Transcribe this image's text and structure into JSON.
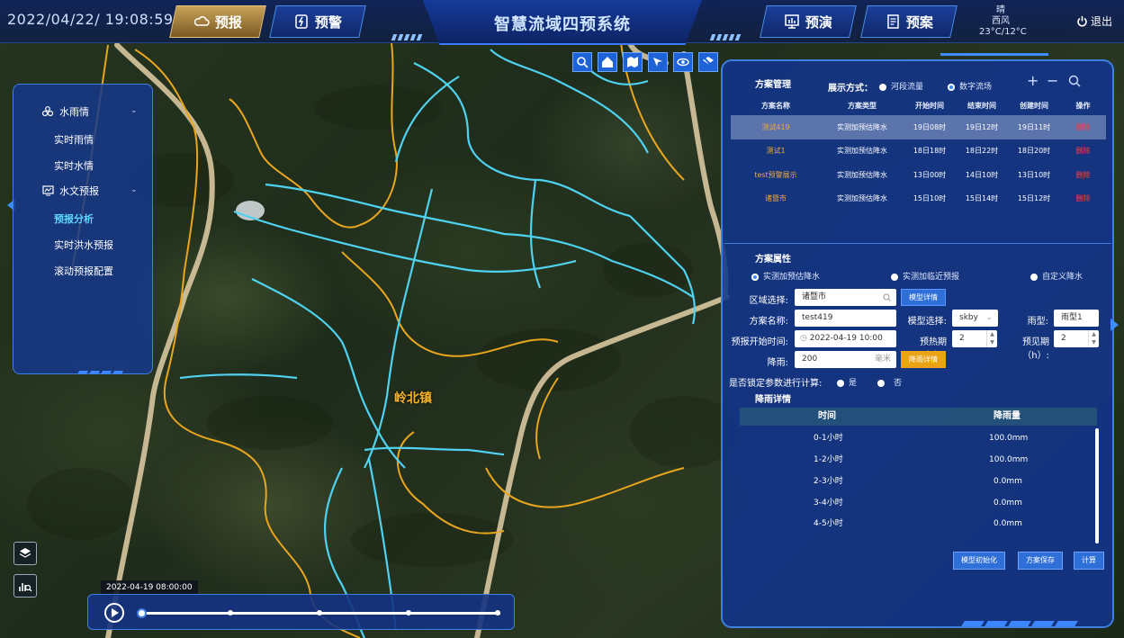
{
  "header": {
    "datetime": "2022/04/22/ 19:08:59",
    "title": "智慧流域四预系统",
    "nav": [
      {
        "label": "预报",
        "icon": "cloud-icon"
      },
      {
        "label": "预警",
        "icon": "alert-icon"
      },
      {
        "label": "预演",
        "icon": "chart-icon"
      },
      {
        "label": "预案",
        "icon": "document-icon"
      }
    ],
    "weather": {
      "condition": "晴",
      "wind": "西风",
      "temperature": "23°C/12°C"
    },
    "logout": "退出"
  },
  "map": {
    "place_label": "岭北镇",
    "tools": [
      "search-icon",
      "home-icon",
      "map-icon",
      "pointer-icon",
      "eye-icon",
      "layer-off-icon"
    ]
  },
  "left_menu": {
    "groups": [
      {
        "label": "水雨情",
        "icon": "water-rain-icon",
        "items": [
          "实时雨情",
          "实时水情"
        ]
      },
      {
        "label": "水文预报",
        "icon": "monitor-icon",
        "items": [
          "预报分析",
          "实时洪水预报",
          "滚动预报配置"
        ]
      }
    ],
    "active_item": "预报分析"
  },
  "timeline": {
    "label": "2022-04-19 08:00:00",
    "progress": 0
  },
  "plan_management": {
    "title": "方案管理",
    "display_mode_label": "展示方式：",
    "display_modes": [
      "河段流量",
      "数字流场"
    ],
    "selected_mode": "数字流场",
    "columns": [
      "方案名称",
      "方案类型",
      "开始时间",
      "结束时间",
      "创建时间",
      "操作"
    ],
    "rows": [
      {
        "name": "测试419",
        "type": "实测加预估降水",
        "start": "19日08时",
        "end": "19日12时",
        "created": "19日11时",
        "op": "删除"
      },
      {
        "name": "测试1",
        "type": "实测加预估降水",
        "start": "18日18时",
        "end": "18日22时",
        "created": "18日20时",
        "op": "删除"
      },
      {
        "name": "test预警展示",
        "type": "实测加预估降水",
        "start": "13日00时",
        "end": "14日10时",
        "created": "13日10时",
        "op": "删除"
      },
      {
        "name": "诸暨市",
        "type": "实测加预估降水",
        "start": "15日10时",
        "end": "15日14时",
        "created": "15日12时",
        "op": "删除"
      }
    ]
  },
  "plan_properties": {
    "title": "方案属性",
    "types": [
      "实测加预估降水",
      "实测加临近预报",
      "自定义降水"
    ],
    "selected_type": "实测加预估降水",
    "region_label": "区域选择:",
    "region_value": "诸暨市",
    "model_detail_btn": "模型详情",
    "plan_name_label": "方案名称:",
    "plan_name_value": "test419",
    "model_select_label": "模型选择:",
    "model_value": "skby",
    "rain_type_label": "雨型:",
    "rain_type_value": "雨型1",
    "start_time_label": "预报开始时间:",
    "start_time_value": "2022-04-19 10:00",
    "warmup_label": "预热期（h）:",
    "warmup_value": "2",
    "foresee_label": "预见期（h）:",
    "foresee_value": "2",
    "rainfall_label": "降雨:",
    "rainfall_value": "200",
    "rainfall_unit": "毫米",
    "rain_detail_btn": "降雨详情",
    "lock_label": "是否锁定参数进行计算:",
    "lock_options": [
      "是",
      "否"
    ],
    "rain_detail_title": "降雨详情",
    "rain_columns": [
      "时间",
      "降雨量"
    ],
    "rain_rows": [
      {
        "time": "0-1小时",
        "amount": "100.0mm"
      },
      {
        "time": "1-2小时",
        "amount": "100.0mm"
      },
      {
        "time": "2-3小时",
        "amount": "0.0mm"
      },
      {
        "time": "3-4小时",
        "amount": "0.0mm"
      },
      {
        "time": "4-5小时",
        "amount": "0.0mm"
      }
    ],
    "buttons": [
      "模型初始化",
      "方案保存",
      "计算"
    ]
  },
  "colors": {
    "river": "#4fd2ef",
    "boundary": "#e8a51e",
    "road": "#d8c7a0",
    "panel": "#12348c",
    "accent": "#3f7fe0"
  }
}
